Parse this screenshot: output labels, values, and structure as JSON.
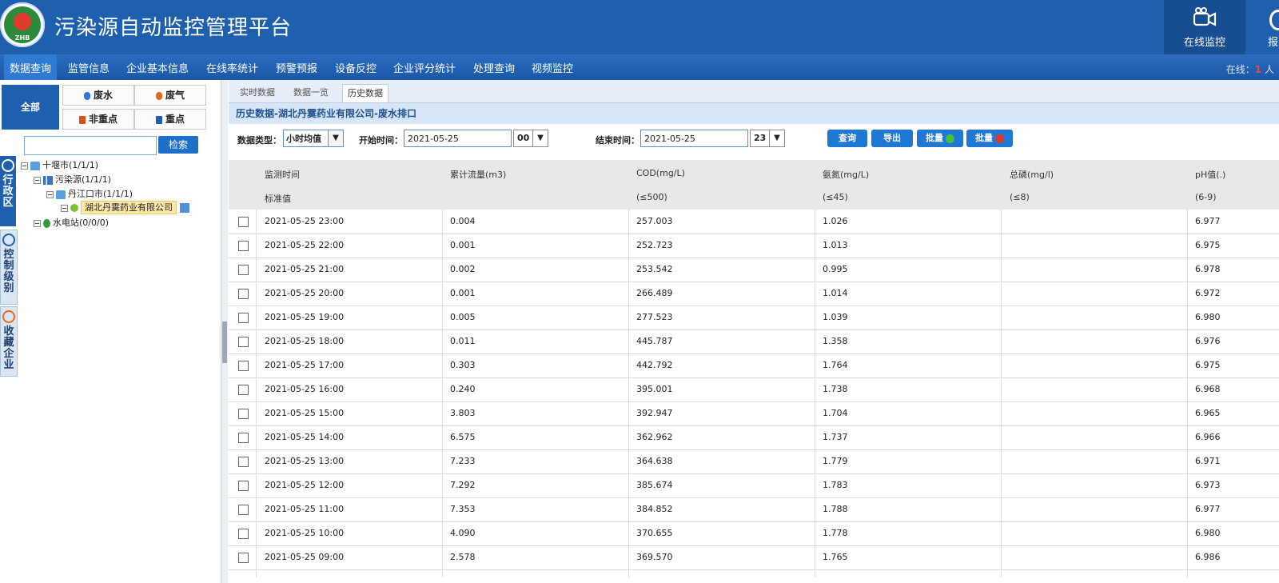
{
  "header": {
    "title": "污染源自动监控管理平台",
    "logo_text": "ZHB",
    "buttons": [
      {
        "label": "在线监控",
        "icon": "video-camera-icon"
      },
      {
        "label": "报",
        "icon": "circle-icon"
      }
    ]
  },
  "nav": {
    "items": [
      "数据查询",
      "监管信息",
      "企业基本信息",
      "在线率统计",
      "预警预报",
      "设备反控",
      "企业评分统计",
      "处理查询",
      "视频监控"
    ],
    "active_index": 0,
    "online_label": "在线：",
    "online_count": "1",
    "online_unit": "人"
  },
  "left": {
    "all_label": "全部",
    "categories": [
      {
        "label": "废水",
        "icon": "water-drop-icon",
        "color": "#2e7bd6"
      },
      {
        "label": "废气",
        "icon": "flame-icon",
        "color": "#e06a1a"
      },
      {
        "label": "非重点",
        "icon": "factory-icon",
        "color": "#d84d1f"
      },
      {
        "label": "重点",
        "icon": "factory-icon",
        "color": "#1e5fae"
      }
    ],
    "search_placeholder": "",
    "search_button": "检索",
    "side_tabs": [
      "行政区",
      "控制级别",
      "收藏企业"
    ],
    "tree": {
      "city": "十堰市(1/1/1)",
      "pollution": "污染源(1/1/1)",
      "county": "丹江口市(1/1/1)",
      "company": "湖北丹霙药业有限公司",
      "hydro": "水电站(0/0/0)"
    }
  },
  "content": {
    "tabs": [
      "实时数据",
      "数据一览",
      "历史数据"
    ],
    "active_tab": 2,
    "breadcrumb": "历史数据-湖北丹霙药业有限公司-废水排口",
    "filter": {
      "type_label": "数据类型：",
      "type_value": "小时均值",
      "start_label": "开始时间：",
      "start_date": "2021-05-25",
      "start_hour": "00",
      "end_label": "结束时间：",
      "end_date": "2021-05-25",
      "end_hour": "23",
      "query": "查询",
      "export": "导出",
      "batch_ok": "批量",
      "batch_cancel": "批量"
    },
    "table": {
      "columns": [
        "监测时间",
        "累计流量(m3)",
        "COD(mg/L)",
        "氨氮(mg/L)",
        "总磷(mg/l)",
        "pH值(.)"
      ],
      "standard_label": "标准值",
      "standards": [
        "",
        "(≤500)",
        "(≤45)",
        "(≤8)",
        "(6-9)"
      ],
      "rows": [
        [
          "2021-05-25 23:00",
          "0.004",
          "257.003",
          "1.026",
          "",
          "6.977"
        ],
        [
          "2021-05-25 22:00",
          "0.001",
          "252.723",
          "1.013",
          "",
          "6.975"
        ],
        [
          "2021-05-25 21:00",
          "0.002",
          "253.542",
          "0.995",
          "",
          "6.978"
        ],
        [
          "2021-05-25 20:00",
          "0.001",
          "266.489",
          "1.014",
          "",
          "6.972"
        ],
        [
          "2021-05-25 19:00",
          "0.005",
          "277.523",
          "1.039",
          "",
          "6.980"
        ],
        [
          "2021-05-25 18:00",
          "0.011",
          "445.787",
          "1.358",
          "",
          "6.976"
        ],
        [
          "2021-05-25 17:00",
          "0.303",
          "442.792",
          "1.764",
          "",
          "6.975"
        ],
        [
          "2021-05-25 16:00",
          "0.240",
          "395.001",
          "1.738",
          "",
          "6.968"
        ],
        [
          "2021-05-25 15:00",
          "3.803",
          "392.947",
          "1.704",
          "",
          "6.965"
        ],
        [
          "2021-05-25 14:00",
          "6.575",
          "362.962",
          "1.737",
          "",
          "6.966"
        ],
        [
          "2021-05-25 13:00",
          "7.233",
          "364.638",
          "1.779",
          "",
          "6.971"
        ],
        [
          "2021-05-25 12:00",
          "7.292",
          "385.674",
          "1.783",
          "",
          "6.973"
        ],
        [
          "2021-05-25 11:00",
          "7.353",
          "384.852",
          "1.788",
          "",
          "6.977"
        ],
        [
          "2021-05-25 10:00",
          "4.090",
          "370.655",
          "1.778",
          "",
          "6.980"
        ],
        [
          "2021-05-25 09:00",
          "2.578",
          "369.570",
          "1.765",
          "",
          "6.986"
        ]
      ]
    }
  }
}
